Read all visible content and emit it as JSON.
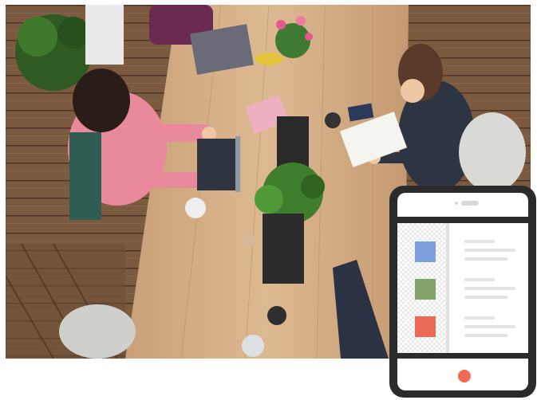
{
  "image": {
    "subject": "coworkers-at-wooden-table-photo"
  },
  "phone_mockup": {
    "swatches": [
      {
        "color": "#7d9fdc"
      },
      {
        "color": "#84a36a"
      },
      {
        "color": "#ea6a55"
      }
    ],
    "home_button_color": "#ea6a55",
    "frame_color": "#2b2b2b"
  }
}
